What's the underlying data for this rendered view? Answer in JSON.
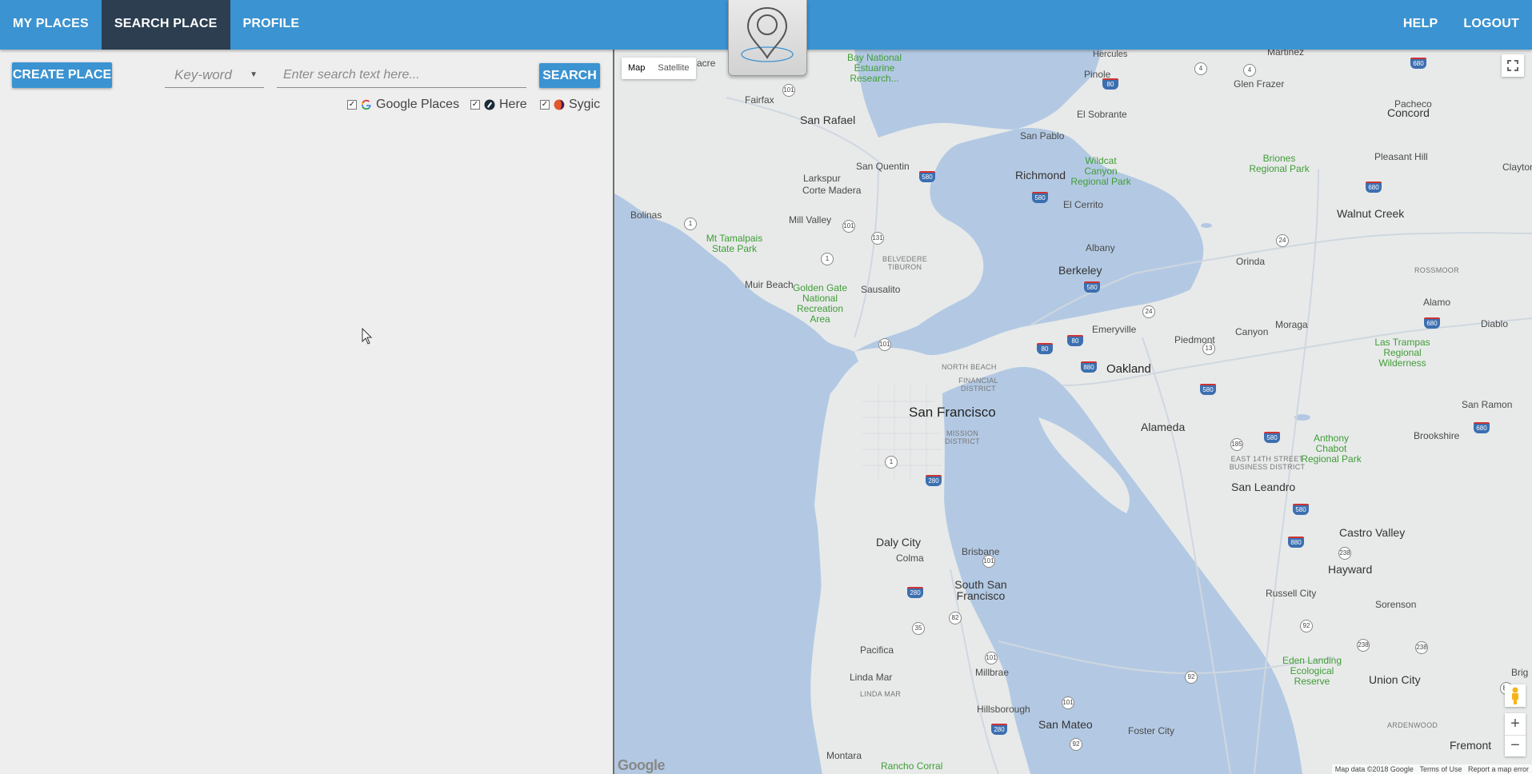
{
  "nav": {
    "left": [
      "MY PLACES",
      "SEARCH PLACE",
      "PROFILE"
    ],
    "right": [
      "HELP",
      "LOGOUT"
    ],
    "active_index": 1
  },
  "toolbar": {
    "create_label": "CREATE PLACE",
    "keyword_value": "Key-word",
    "search_placeholder": "Enter search text here...",
    "search_label": "SEARCH"
  },
  "providers": [
    {
      "name": "Google Places",
      "checked": true,
      "icon": "google-icon"
    },
    {
      "name": "Here",
      "checked": true,
      "icon": "here-icon"
    },
    {
      "name": "Sygic",
      "checked": true,
      "icon": "sygic-icon"
    }
  ],
  "map": {
    "type_map": "Map",
    "type_satellite": "Satellite",
    "cities": {
      "san_francisco": "San Francisco",
      "oakland": "Oakland",
      "berkeley": "Berkeley",
      "richmond": "Richmond",
      "san_rafael": "San Rafael",
      "daly_city": "Daly City",
      "south_sf": "South San Francisco",
      "san_mateo": "San Mateo",
      "hayward": "Hayward",
      "san_leandro": "San Leandro",
      "alameda": "Alameda",
      "walnut_creek": "Walnut Creek",
      "concord": "Concord",
      "fremont": "Fremont",
      "union_city": "Union City",
      "castro_valley": "Castro Valley",
      "pacifica": "Pacifica",
      "millbrae": "Millbrae",
      "hillsborough": "Hillsborough",
      "foster_city": "Foster City",
      "sausalito": "Sausalito",
      "mill_valley": "Mill Valley",
      "larkspur": "Larkspur",
      "corte_madera": "Corte Madera",
      "san_quentin": "San Quentin",
      "bolinas": "Bolinas",
      "muir_beach": "Muir Beach",
      "fairfax": "Fairfax",
      "pinole": "Pinole",
      "hercules": "Hercules",
      "el_sobrante": "El Sobrante",
      "san_pablo": "San Pablo",
      "el_cerrito": "El Cerrito",
      "albany": "Albany",
      "emeryville": "Emeryville",
      "piedmont": "Piedmont",
      "canyon": "Canyon",
      "moraga": "Moraga",
      "orinda": "Orinda",
      "pleasant_hill": "Pleasant Hill",
      "pacheco": "Pacheco",
      "glen_frazer": "Glen Frazer",
      "martinez": "Martinez",
      "clayton": "Clayton",
      "alamo": "Alamo",
      "diablo": "Diablo",
      "san_ramon": "San Ramon",
      "brookshire": "Brookshire",
      "sorenson": "Sorenson",
      "russell_city": "Russell City",
      "brisbane": "Brisbane",
      "colma": "Colma",
      "linda_mar": "Linda Mar",
      "montara": "Montara",
      "acre": "acre",
      "brig": "Brig"
    },
    "parks": {
      "bay_national": "Bay National Estuarine Research...",
      "wildcat": "Wildcat Canyon Regional Park",
      "briones": "Briones Regional Park",
      "mt_tamalpais": "Mt Tamalpais State Park",
      "golden_gate": "Golden Gate National Recreation Area",
      "las_trampas": "Las Trampas Regional Wilderness",
      "anthony_chabot": "Anthony Chabot Regional Park",
      "eden_landing": "Eden Landing Ecological Reserve",
      "rancho_corral": "Rancho Corral"
    },
    "districts": {
      "north_beach": "NORTH BEACH",
      "financial": "FINANCIAL DISTRICT",
      "mission": "MISSION DISTRICT",
      "belvedere": "BELVEDERE TIBURON",
      "rossmoor": "ROSSMOOR",
      "east14": "EAST 14TH STREET BUSINESS DISTRICT",
      "linda_mar_dist": "LINDA MAR",
      "ardenwood": "ARDENWOOD"
    },
    "shields": [
      "580",
      "580",
      "580",
      "80",
      "80",
      "880",
      "580",
      "580",
      "280",
      "280",
      "280",
      "880",
      "580",
      "680",
      "680",
      "680",
      "680",
      "80"
    ],
    "routes": [
      "101",
      "1",
      "131",
      "101",
      "1",
      "101",
      "4",
      "4",
      "24",
      "13",
      "24",
      "185",
      "1",
      "35",
      "82",
      "101",
      "101",
      "92",
      "238",
      "238",
      "92",
      "238",
      "84",
      "92",
      "101"
    ],
    "attribution": "Map data ©2018 Google",
    "terms": "Terms of Use",
    "report": "Report a map error",
    "google_logo": "Google"
  },
  "colors": {
    "nav": "#3b93d1",
    "nav_active": "#2c3e50",
    "water": "#b4cae3",
    "park": "#3f9d36"
  }
}
